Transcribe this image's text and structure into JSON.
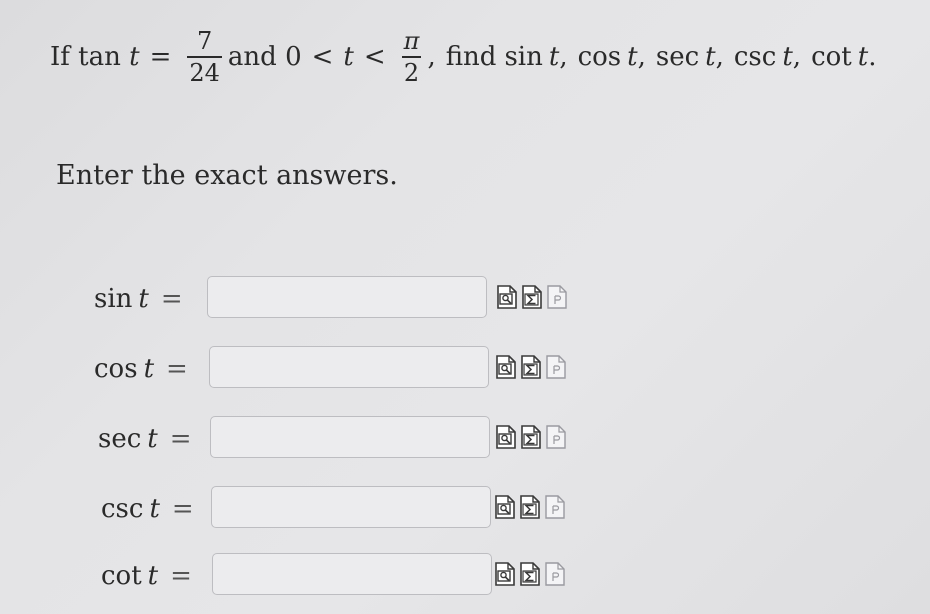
{
  "question": {
    "prefix": "If tan",
    "var_t": "t",
    "equals": "=",
    "frac1_num": "7",
    "frac1_den": "24",
    "and_text": "and 0",
    "lt1": "<",
    "var_t2": "t",
    "lt2": "<",
    "frac2_num": "π",
    "frac2_den": "2",
    "comma": ",",
    "find_text": "find",
    "targets": [
      {
        "fn": "sin",
        "var": "t",
        "sep": ","
      },
      {
        "fn": "cos",
        "var": "t",
        "sep": ","
      },
      {
        "fn": "sec",
        "var": "t",
        "sep": ","
      },
      {
        "fn": "csc",
        "var": "t",
        "sep": ","
      },
      {
        "fn": "cot",
        "var": "t",
        "sep": "."
      }
    ]
  },
  "instruction": "Enter the exact answers.",
  "answers": [
    {
      "fn": "sin",
      "var": "t",
      "eq": "=",
      "value": "",
      "placeholder": ""
    },
    {
      "fn": "cos",
      "var": "t",
      "eq": "=",
      "value": "",
      "placeholder": ""
    },
    {
      "fn": "sec",
      "var": "t",
      "eq": "=",
      "value": "",
      "placeholder": ""
    },
    {
      "fn": "csc",
      "var": "t",
      "eq": "=",
      "value": "",
      "placeholder": ""
    },
    {
      "fn": "cot",
      "var": "t",
      "eq": "=",
      "value": "",
      "placeholder": ""
    }
  ],
  "tool_icons": [
    "image-search-icon",
    "equation-editor-icon",
    "preview-icon"
  ],
  "colors": {
    "icon_border": "#3a3a3a",
    "icon_fill": "#ffffff",
    "preview_border": "#9a9aa0"
  }
}
